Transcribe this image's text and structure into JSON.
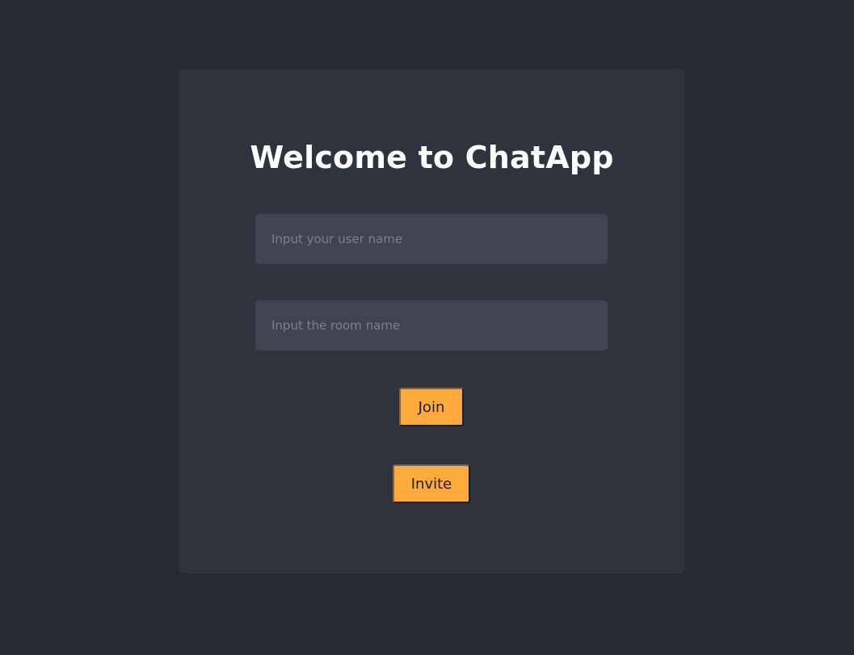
{
  "app": {
    "title": "Welcome to ChatApp"
  },
  "form": {
    "username": {
      "value": "",
      "placeholder": "Input your user name"
    },
    "room": {
      "value": "",
      "placeholder": "Input the room name"
    },
    "join_label": "Join",
    "invite_label": "Invite"
  },
  "colors": {
    "background": "#282a33",
    "card": "#2e333e",
    "input": "#414450",
    "accent": "#ffaa3c",
    "title_text": "#ffffff"
  }
}
